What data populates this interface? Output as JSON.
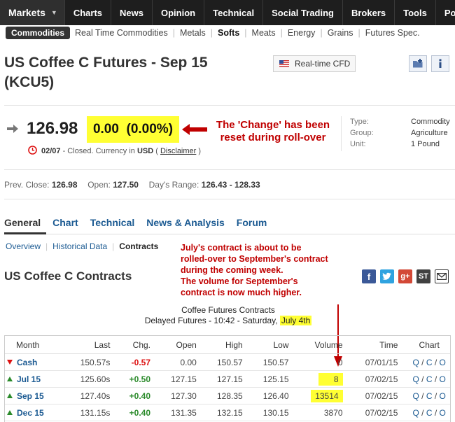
{
  "nav": {
    "markets": "Markets",
    "items": [
      "Charts",
      "News",
      "Opinion",
      "Technical",
      "Social Trading",
      "Brokers",
      "Tools",
      "Por"
    ]
  },
  "subnav": {
    "badge": "Commodities",
    "items": [
      "Real Time Commodities",
      "Metals",
      "Softs",
      "Meats",
      "Energy",
      "Grains",
      "Futures Spec."
    ],
    "active": "Softs"
  },
  "instrument": {
    "title": "US Coffee C Futures - Sep 15 (KCU5)",
    "cfd_label": "Real-time CFD",
    "price": "126.98",
    "change": "0.00  (0.00%)",
    "status": {
      "time": "02/07",
      "text": " - Closed. Currency in ",
      "currency": "USD",
      "disclaimer_open": " ( ",
      "disclaimer": "Disclaimer",
      "disclaimer_close": " )"
    },
    "info": [
      {
        "key": "Type:",
        "value": "Commodity"
      },
      {
        "key": "Group:",
        "value": "Agriculture"
      },
      {
        "key": "Unit:",
        "value": "1 Pound"
      }
    ],
    "stats": {
      "prev_close_label": "Prev. Close:",
      "prev_close": "126.98",
      "open_label": "Open:",
      "open": "127.50",
      "range_label": "Day's Range:",
      "range": "126.43 - 128.33"
    }
  },
  "annotations": {
    "change_note": "The 'Change' has been reset during roll-over",
    "contract_note": [
      "July's contract is about to be",
      "rolled-over to September's contract",
      "during the coming week.",
      "The volume for September's",
      "contract is now much higher."
    ]
  },
  "tabs": {
    "items": [
      "General",
      "Chart",
      "Technical",
      "News & Analysis",
      "Forum"
    ],
    "active": "General",
    "subtabs": [
      "Overview",
      "Historical Data",
      "Contracts"
    ],
    "active_subtab": "Contracts"
  },
  "contracts": {
    "title": "US Coffee C Contracts",
    "caption": "Coffee Futures Contracts",
    "caption2_prefix": "Delayed Futures - 10:42 - Saturday, ",
    "caption2_date": "July 4th",
    "columns": [
      "Month",
      "Last",
      "Chg.",
      "Open",
      "High",
      "Low",
      "Volume",
      "Time",
      "Chart"
    ],
    "chart_links": [
      "Q",
      "C",
      "O"
    ],
    "rows": [
      {
        "month": "Cash",
        "direction": "down",
        "last": "150.57s",
        "chg": "-0.57",
        "open": "0.00",
        "high": "150.57",
        "low": "150.57",
        "volume": "0",
        "time": "07/01/15",
        "highlight": false
      },
      {
        "month": "Jul 15",
        "direction": "up",
        "last": "125.60s",
        "chg": "+0.50",
        "open": "127.15",
        "high": "127.15",
        "low": "125.15",
        "volume": "8",
        "time": "07/02/15",
        "highlight": true
      },
      {
        "month": "Sep 15",
        "direction": "up",
        "last": "127.40s",
        "chg": "+0.40",
        "open": "127.30",
        "high": "128.35",
        "low": "126.40",
        "volume": "13514",
        "time": "07/02/15",
        "highlight": true
      },
      {
        "month": "Dec 15",
        "direction": "up",
        "last": "131.15s",
        "chg": "+0.40",
        "open": "131.35",
        "high": "132.15",
        "low": "130.15",
        "volume": "3870",
        "time": "07/02/15",
        "highlight": false
      }
    ]
  },
  "colors": {
    "highlight": "#ffff33",
    "annotation": "#c00000",
    "link": "#1b5a92",
    "positive": "#2a8a2a",
    "negative": "#dd1111"
  },
  "icons": {
    "social": [
      "facebook-icon",
      "twitter-icon",
      "google-plus-icon",
      "stocktwits-icon",
      "email-icon"
    ]
  }
}
